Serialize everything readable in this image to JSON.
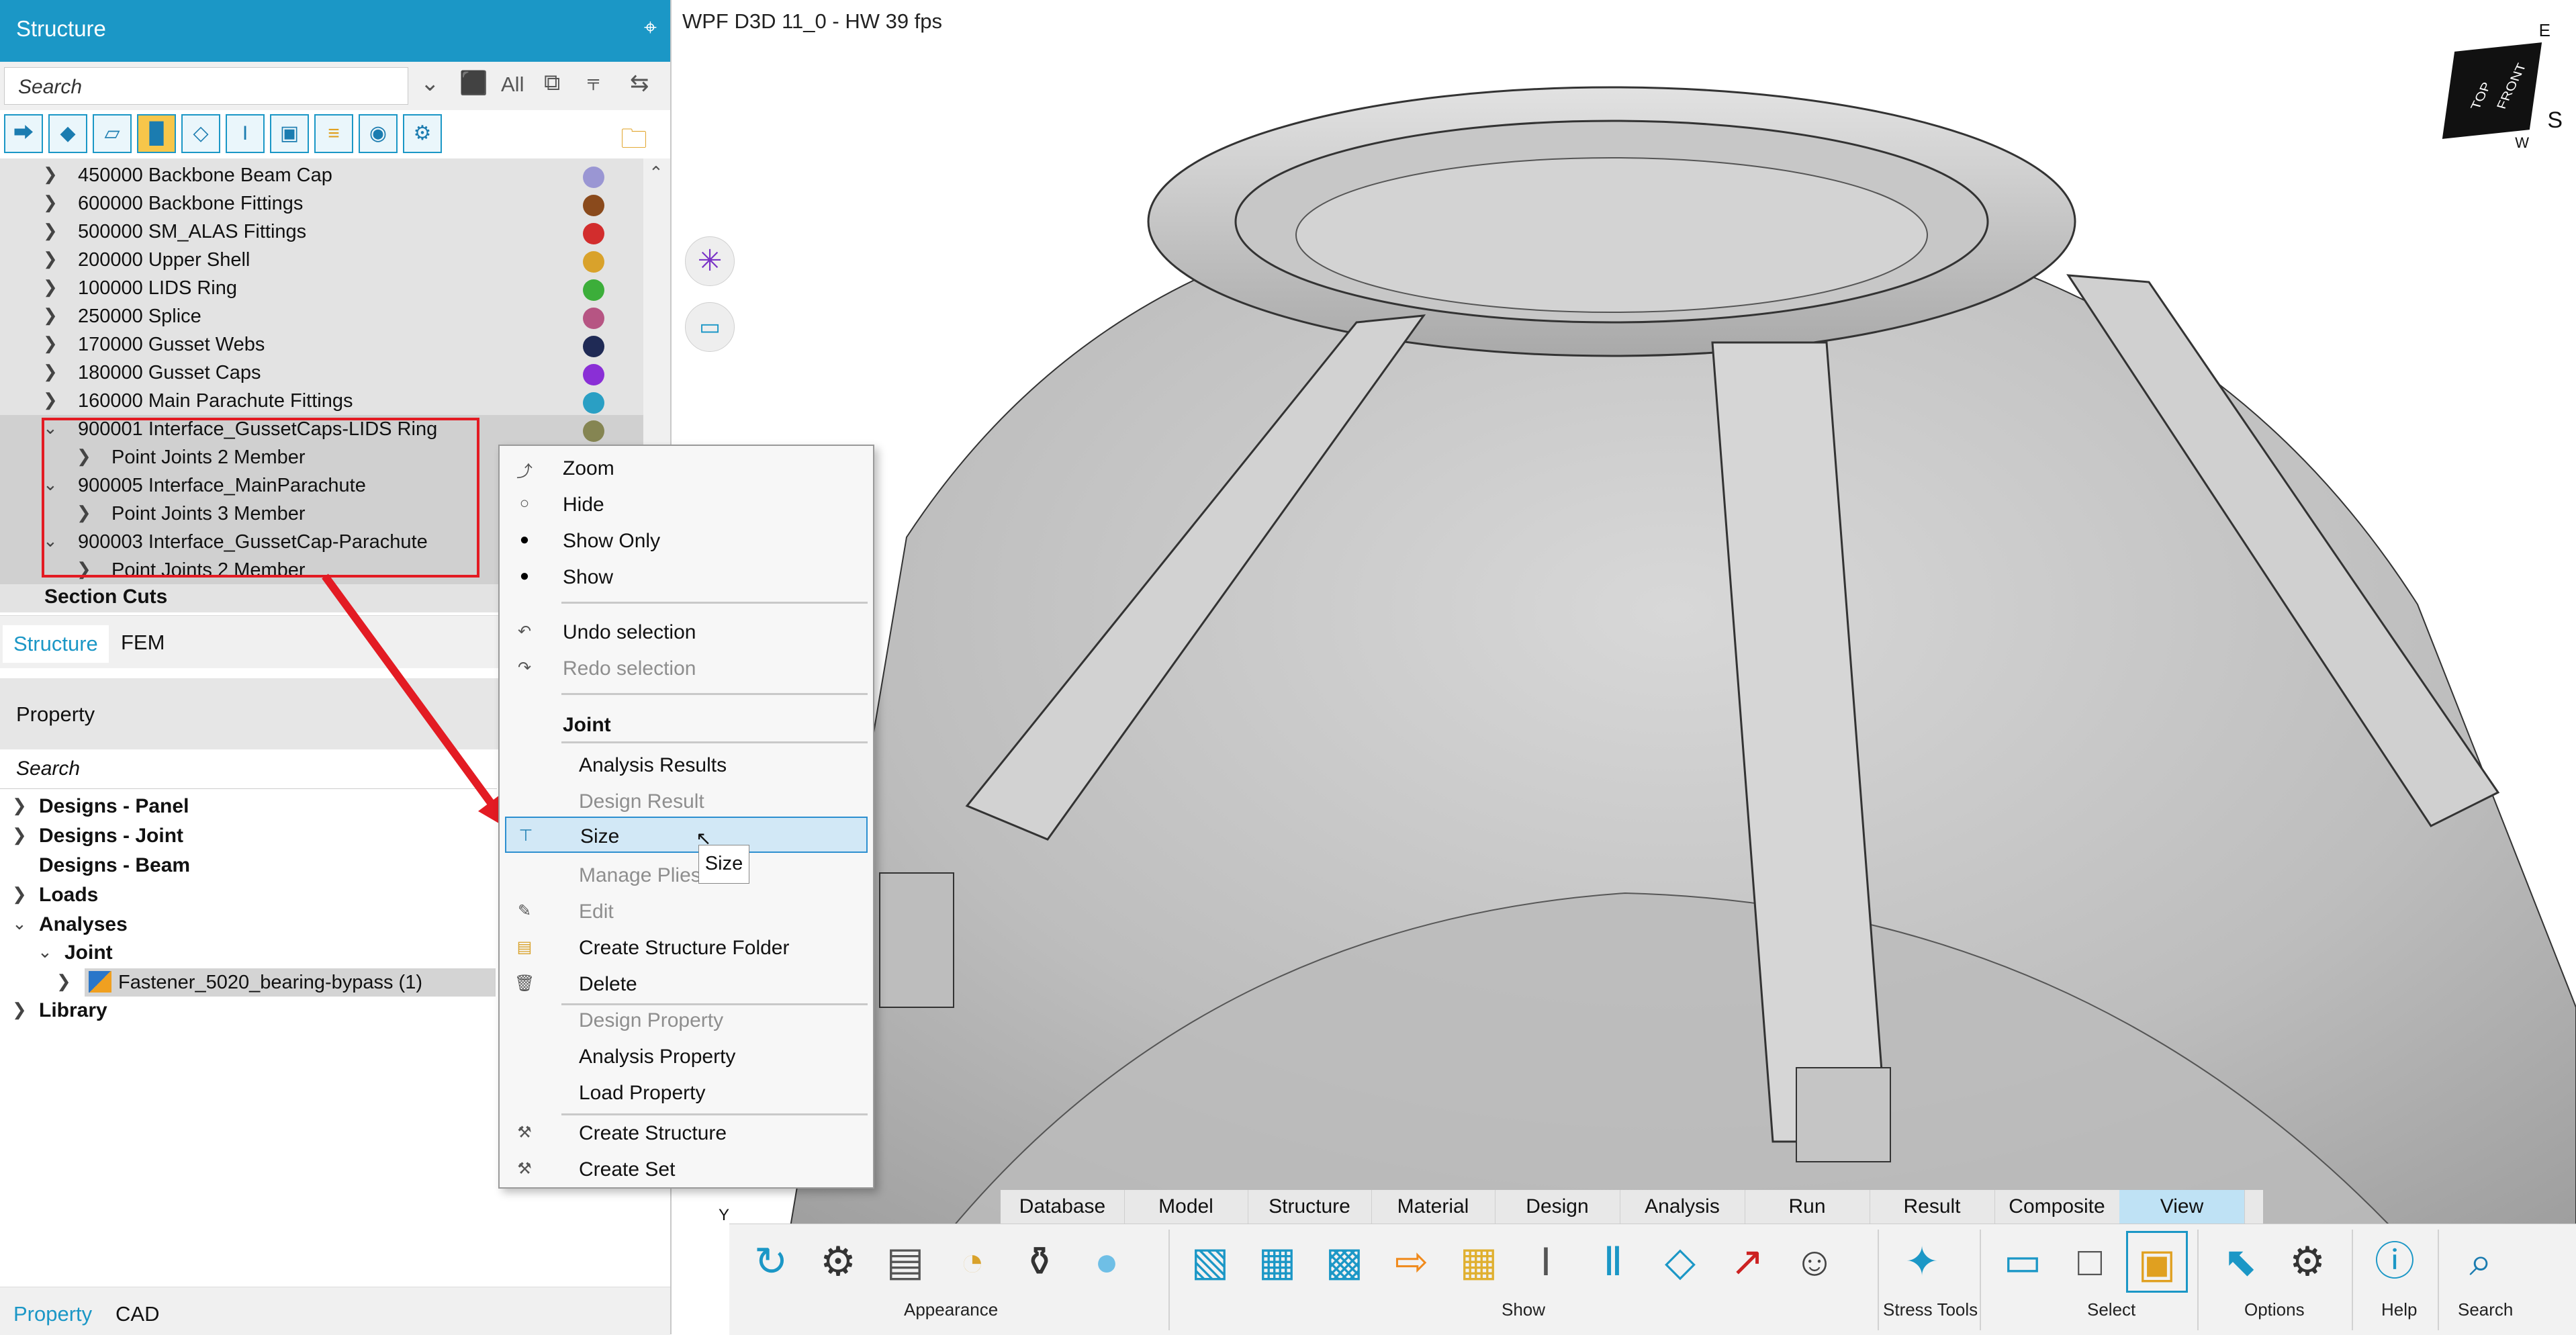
{
  "left_panel": {
    "title": "Structure",
    "pin_icon": "pin-icon",
    "search_placeholder": "Search",
    "filter_all": "All",
    "tree": [
      {
        "label": "450000 Backbone Beam Cap",
        "color": "#9a96d3"
      },
      {
        "label": "600000 Backbone Fittings",
        "color": "#8a4a1c"
      },
      {
        "label": "500000 SM_ALAS Fittings",
        "color": "#d22d2d"
      },
      {
        "label": "200000 Upper Shell",
        "color": "#d9a22b"
      },
      {
        "label": "100000 LIDS Ring",
        "color": "#3cae3a"
      },
      {
        "label": "250000 Splice",
        "color": "#b65583"
      },
      {
        "label": "170000 Gusset Webs",
        "color": "#1f2a55"
      },
      {
        "label": "180000 Gusset Caps",
        "color": "#8a2fd6"
      },
      {
        "label": "160000 Main Parachute Fittings",
        "color": "#2a9fc4"
      },
      {
        "label": "900001 Interface_GussetCaps-LIDS Ring",
        "color": "#858552"
      },
      {
        "label": "Point Joints 2 Member"
      },
      {
        "label": "900005 Interface_MainParachute"
      },
      {
        "label": "Point Joints 3 Member"
      },
      {
        "label": "900003 Interface_GussetCap-Parachute"
      },
      {
        "label": "Point Joints 2 Member"
      }
    ],
    "section_cuts": "Section Cuts",
    "tabs": [
      "Structure",
      "FEM"
    ],
    "property_title": "Property",
    "property_search": "Search",
    "property_tree": {
      "designs_panel": "Designs - Panel",
      "designs_joint": "Designs - Joint",
      "designs_beam": "Designs - Beam",
      "loads": "Loads",
      "analyses": "Analyses",
      "joint": "Joint",
      "fastener": "Fastener_5020_bearing-bypass (1)",
      "library": "Library"
    },
    "bottom_tabs": [
      "Property",
      "CAD"
    ]
  },
  "viewport": {
    "status": "WPF D3D 11_0 - HW  39 fps",
    "cube_labels": {
      "top": "TOP",
      "front": "FRONT",
      "e": "E",
      "s": "S",
      "w": "W"
    },
    "axis_label": "Y"
  },
  "context_menu": {
    "items": [
      {
        "label": "Zoom",
        "icon": "zoom-icon"
      },
      {
        "label": "Hide",
        "icon": "hide-icon"
      },
      {
        "label": "Show Only",
        "icon": "show-only-icon"
      },
      {
        "label": "Show",
        "icon": "show-icon"
      },
      {
        "label": "Undo selection",
        "icon": "undo-icon"
      },
      {
        "label": "Redo selection",
        "icon": "redo-icon",
        "disabled": true
      },
      {
        "label": "Joint",
        "header": true
      },
      {
        "label": "Analysis Results"
      },
      {
        "label": "Design Result",
        "disabled": true
      },
      {
        "label": "Size",
        "icon": "size-icon",
        "highlighted": true
      },
      {
        "label": "Manage Plies",
        "disabled": true
      },
      {
        "label": "Edit",
        "icon": "edit-icon",
        "disabled": true
      },
      {
        "label": "Create Structure Folder",
        "icon": "folder-icon"
      },
      {
        "label": "Delete",
        "icon": "trash-icon"
      },
      {
        "label": "Design Property",
        "disabled": true
      },
      {
        "label": "Analysis Property"
      },
      {
        "label": "Load Property"
      },
      {
        "label": "Create Structure",
        "icon": "structure-icon"
      },
      {
        "label": "Create Set",
        "icon": "set-icon"
      }
    ],
    "tooltip": "Size"
  },
  "ribbon": {
    "tabs": [
      "Database",
      "Model",
      "Structure",
      "Material",
      "Design",
      "Analysis",
      "Run",
      "Result",
      "Composite",
      "View"
    ],
    "active_tab": "View",
    "groups": [
      "Appearance",
      "Show",
      "Stress Tools",
      "Select",
      "Options",
      "Help",
      "Search"
    ]
  },
  "colors": {
    "accent": "#1b97c6",
    "highlight_box": "#e31b23",
    "arrow": "#e31b23"
  }
}
